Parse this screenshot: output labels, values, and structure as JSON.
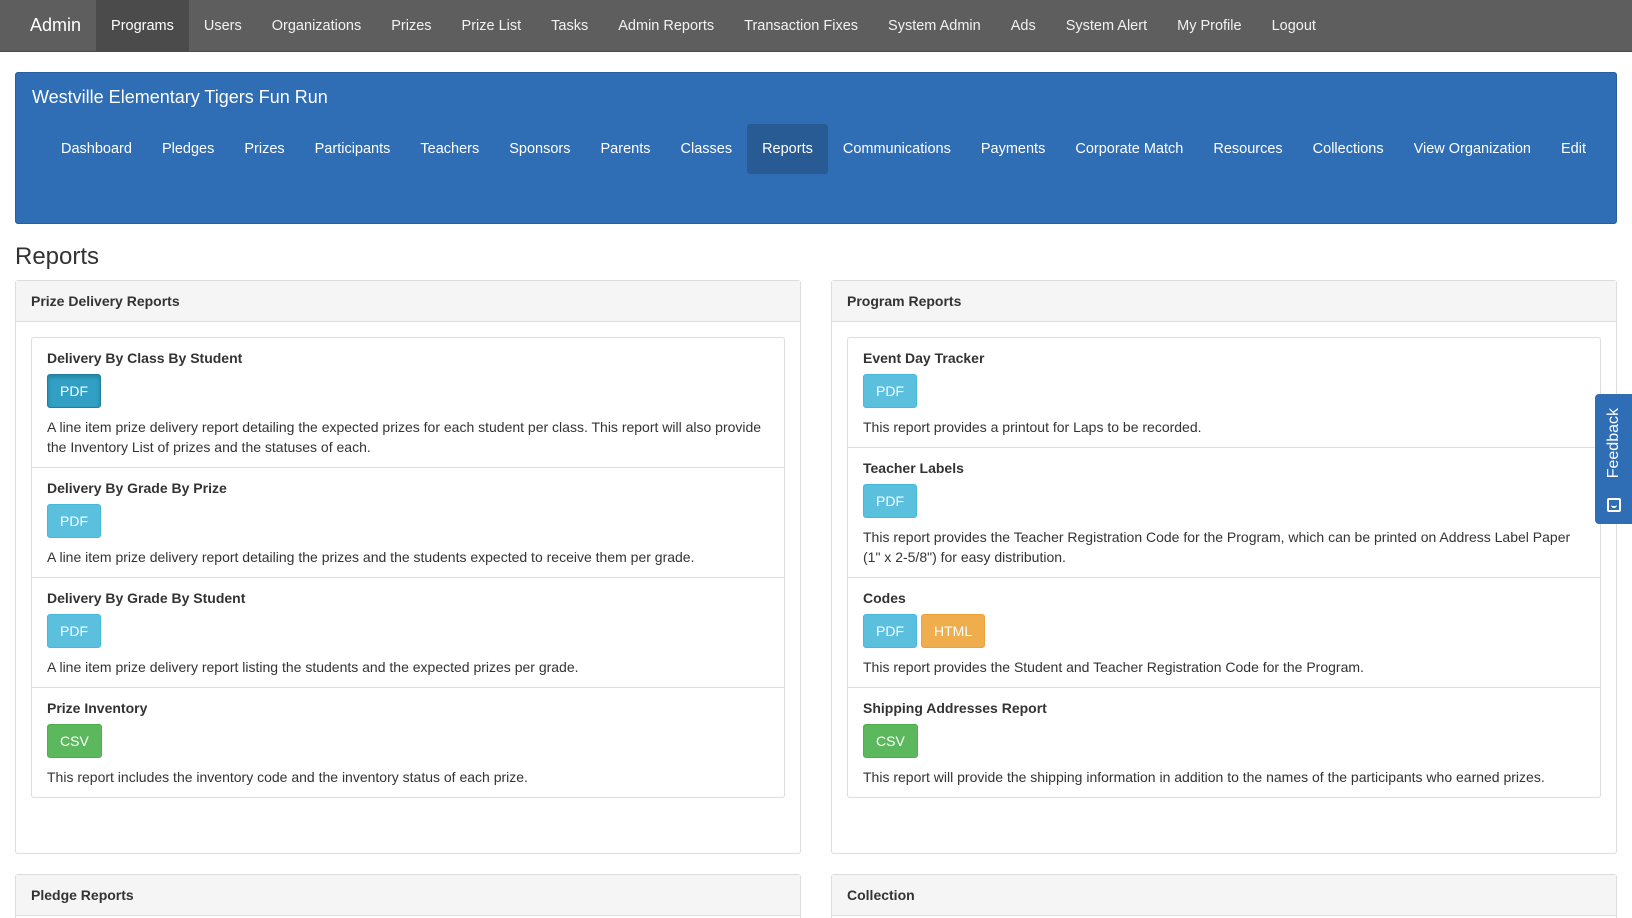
{
  "topnav": {
    "brand": "Admin",
    "items": [
      "Programs",
      "Users",
      "Organizations",
      "Prizes",
      "Prize List",
      "Tasks",
      "Admin Reports",
      "Transaction Fixes",
      "System Admin",
      "Ads",
      "System Alert",
      "My Profile",
      "Logout"
    ],
    "active": "Programs"
  },
  "org": {
    "title": "Westville Elementary Tigers Fun Run",
    "nav": [
      "Dashboard",
      "Pledges",
      "Prizes",
      "Participants",
      "Teachers",
      "Sponsors",
      "Parents",
      "Classes",
      "Reports",
      "Communications",
      "Payments",
      "Corporate Match",
      "Resources",
      "Collections",
      "View Organization",
      "Edit"
    ],
    "active": "Reports"
  },
  "page": {
    "title": "Reports"
  },
  "panels": {
    "prize_delivery": {
      "heading": "Prize Delivery Reports",
      "items": [
        {
          "title": "Delivery By Class By Student",
          "buttons": [
            "PDF"
          ],
          "desc": "A line item prize delivery report detailing the expected prizes for each student per class. This report will also provide the Inventory List of prizes and the statuses of each."
        },
        {
          "title": "Delivery By Grade By Prize",
          "buttons": [
            "PDF"
          ],
          "desc": "A line item prize delivery report detailing the prizes and the students expected to receive them per grade."
        },
        {
          "title": "Delivery By Grade By Student",
          "buttons": [
            "PDF"
          ],
          "desc": "A line item prize delivery report listing the students and the expected prizes per grade."
        },
        {
          "title": "Prize Inventory",
          "buttons": [
            "CSV"
          ],
          "desc": "This report includes the inventory code and the inventory status of each prize."
        }
      ]
    },
    "program": {
      "heading": "Program Reports",
      "items": [
        {
          "title": "Event Day Tracker",
          "buttons": [
            "PDF"
          ],
          "desc": "This report provides a printout for Laps to be recorded."
        },
        {
          "title": "Teacher Labels",
          "buttons": [
            "PDF"
          ],
          "desc": "This report provides the Teacher Registration Code for the Program, which can be printed on Address Label Paper (1\" x 2-5/8\") for easy distribution."
        },
        {
          "title": "Codes",
          "buttons": [
            "PDF",
            "HTML"
          ],
          "desc": "This report provides the Student and Teacher Registration Code for the Program."
        },
        {
          "title": "Shipping Addresses Report",
          "buttons": [
            "CSV"
          ],
          "desc": "This report will provide the shipping information in addition to the names of the participants who earned prizes."
        }
      ]
    },
    "pledge": {
      "heading": "Pledge Reports"
    },
    "collection": {
      "heading": "Collection"
    }
  },
  "feedback": {
    "label": "Feedback",
    "icon": "feedback-smile-icon"
  },
  "colors": {
    "navbar": "#5e5e5e",
    "org_panel": "#2f6db5",
    "info": "#5bc0de",
    "warning": "#f0ad4e",
    "success": "#5cb85c"
  }
}
